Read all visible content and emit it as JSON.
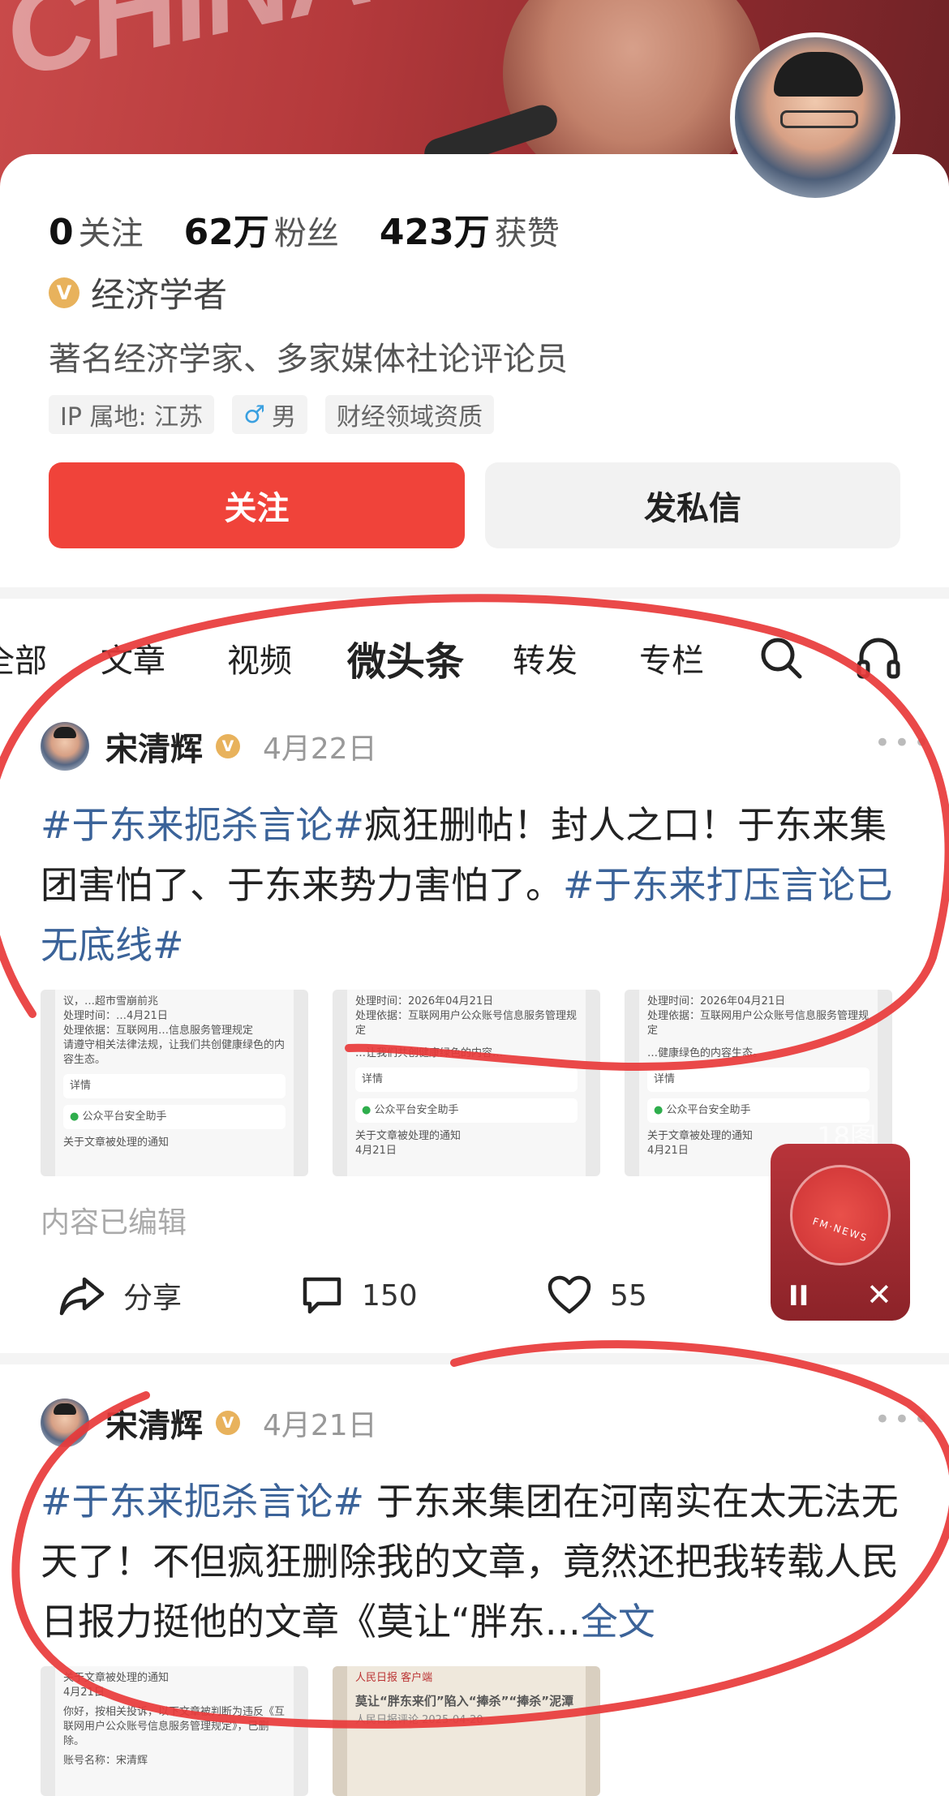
{
  "banner": {
    "text": "CHINA conferen"
  },
  "profile": {
    "stats": [
      {
        "num": "0",
        "label": "关注"
      },
      {
        "num": "62万",
        "label": "粉丝"
      },
      {
        "num": "423万",
        "label": "获赞"
      }
    ],
    "verify_badge": "V",
    "title": "经济学者",
    "description": "著名经济学家、多家媒体社论评论员",
    "tags": {
      "ip": "IP 属地: 江苏",
      "gender": "男",
      "field": "财经领域资质"
    },
    "follow_label": "关注",
    "message_label": "发私信"
  },
  "tabs": [
    "全部",
    "文章",
    "视频",
    "微头条",
    "转发",
    "专栏"
  ],
  "posts": [
    {
      "author": "宋清辉",
      "date": "4月22日",
      "hashtag1": "#于东来扼杀言论#",
      "body": "疯狂删帖！封人之口！于东来集团害怕了、于东来势力害怕了。",
      "hashtag2": "#于东来打压言论已无底线#",
      "image_count": "18图",
      "edited": "内容已编辑",
      "share_label": "分享",
      "comments": "150",
      "likes": "55",
      "thumbs": [
        {
          "l1": "议，…超市雪崩前兆",
          "l2": "处理时间：…4月21日",
          "l3": "处理依据：互联网用…信息服务管理规定",
          "l4": "请遵守相关法律法规，让我们共创健康绿色的内容生态。",
          "detail": "详情",
          "assistant": "公众平台安全助手",
          "notice": "关于文章被处理的通知",
          "ndate": ""
        },
        {
          "l1": "处理时间：2026年04月21日",
          "l2": "处理依据：互联网用户公众账号信息服务管理规定",
          "l3": "",
          "l4": "…让我们共创健康绿色的内容…",
          "detail": "详情",
          "assistant": "公众平台安全助手",
          "notice": "关于文章被处理的通知",
          "ndate": "4月21日"
        },
        {
          "l1": "处理时间：2026年04月21日",
          "l2": "处理依据：互联网用户公众账号信息服务管理规定",
          "l3": "",
          "l4": "…健康绿色的内容生态。",
          "detail": "详情",
          "assistant": "公众平台安全助手",
          "notice": "关于文章被处理的通知",
          "ndate": "4月21日"
        }
      ]
    },
    {
      "author": "宋清辉",
      "date": "4月21日",
      "hashtag1": "#于东来扼杀言论#",
      "body": " 于东来集团在河南实在太无法无天了！不但疯狂删除我的文章，竟然还把我转载人民日报力挺他的文章《莫让“胖东...",
      "full_link": "全文",
      "thumbs": [
        {
          "l1": "关于文章被处理的通知",
          "l2": "4月21日",
          "l3": "你好，按相关投诉，以下文章被判断为违反《互联网用户公众账号信息服务管理规定》，已删除。",
          "l4": "账号名称：宋清辉"
        },
        {
          "l1": "人民日报 客户端",
          "l2": "莫让“胖东来们”陷入“捧杀”“捧杀”泥潭",
          "l3": "人民日报评论 2025-04-20",
          "l4": ""
        }
      ]
    }
  ],
  "player": {
    "label": "FM·NEWS",
    "pause": "II",
    "close": "✕"
  },
  "colors": {
    "accent": "#f0433a",
    "hashtag": "#3b6399",
    "verify": "#e8b25c",
    "marker": "#e83a3a"
  }
}
